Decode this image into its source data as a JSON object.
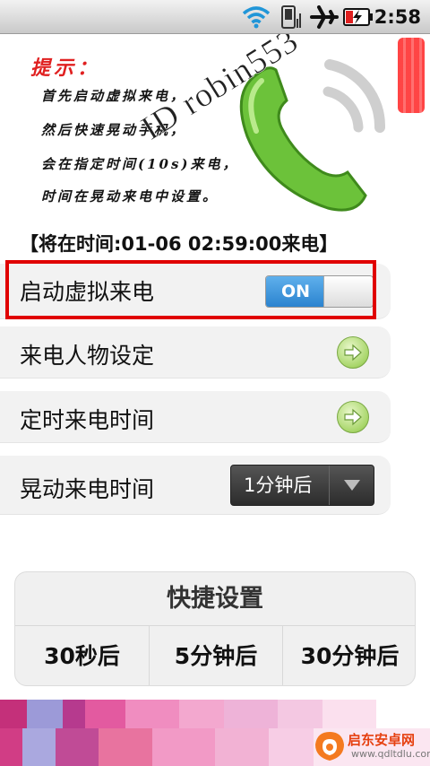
{
  "status_bar": {
    "time": "2:58",
    "icons": [
      "wifi-icon",
      "signal-icon",
      "airplane-icon",
      "battery-charging-icon"
    ]
  },
  "banner": {
    "tip_title": "提示：",
    "tip_lines": [
      "首先启动虚拟来电，",
      "然后快速晃动手机，",
      "会在指定时间(10s)来电，",
      "时间在晃动来电中设置。"
    ],
    "watermark": "ID robin553",
    "icon": "phone-handset-icon"
  },
  "schedule_text": "【将在时间:01-06 02:59:00来电】",
  "settings": {
    "enable_label": "启动虚拟来电",
    "toggle_state": "ON",
    "caller_label": "来电人物设定",
    "timer_label": "定时来电时间",
    "shake_label": "晃动来电时间",
    "shake_value": "1分钟后"
  },
  "quick": {
    "title": "快捷设置",
    "buttons": [
      "30秒后",
      "5分钟后",
      "30分钟后"
    ]
  },
  "footer": {
    "brand": "启东安卓网",
    "url": "www.qdltdlu.com"
  },
  "colors": {
    "accent_blue": "#2b83cf",
    "highlight_red": "#e00000",
    "arrow_green": "#8ec45a"
  }
}
